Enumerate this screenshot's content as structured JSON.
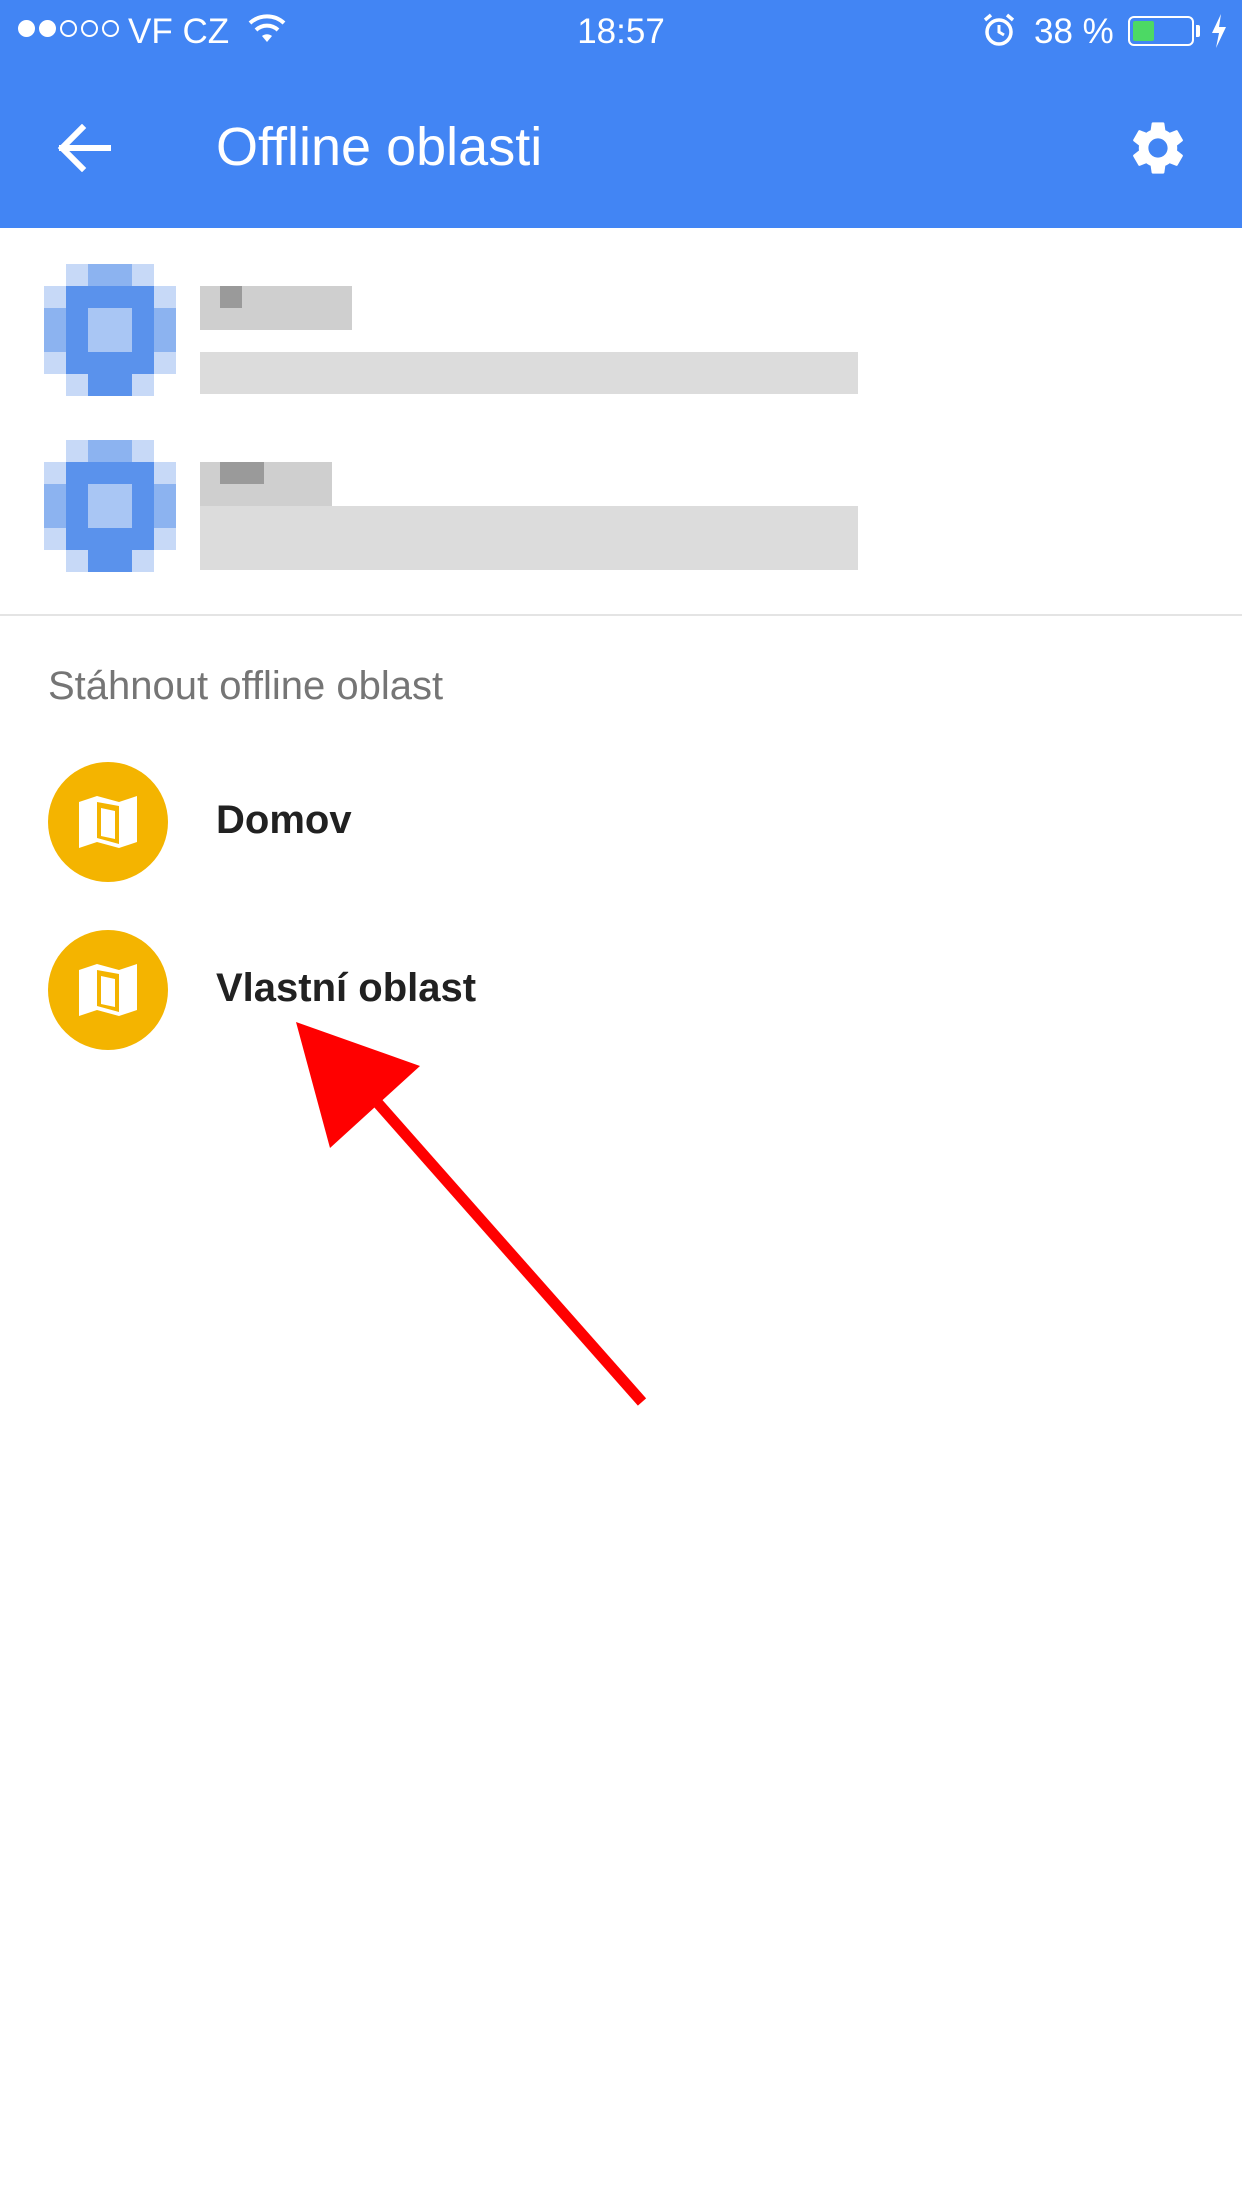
{
  "status_bar": {
    "carrier": "VF CZ",
    "time": "18:57",
    "battery_percent": "38 %",
    "battery_level": 0.38,
    "signal_bars_filled": 2,
    "signal_bars_total": 5
  },
  "app_bar": {
    "title": "Offline oblasti",
    "back_icon": "arrow-back-icon",
    "settings_icon": "gear-icon",
    "color": "#4285f4"
  },
  "downloaded_areas": [
    {
      "name": "",
      "details": ""
    },
    {
      "name": "",
      "details": ""
    }
  ],
  "download_section": {
    "label": "Stáhnout offline oblast",
    "items": [
      {
        "label": "Domov",
        "icon": "map-icon"
      },
      {
        "label": "Vlastní oblast",
        "icon": "map-icon"
      }
    ],
    "icon_color": "#f4b400"
  },
  "annotation": {
    "color": "#ff0000",
    "icon": "red-arrow"
  }
}
